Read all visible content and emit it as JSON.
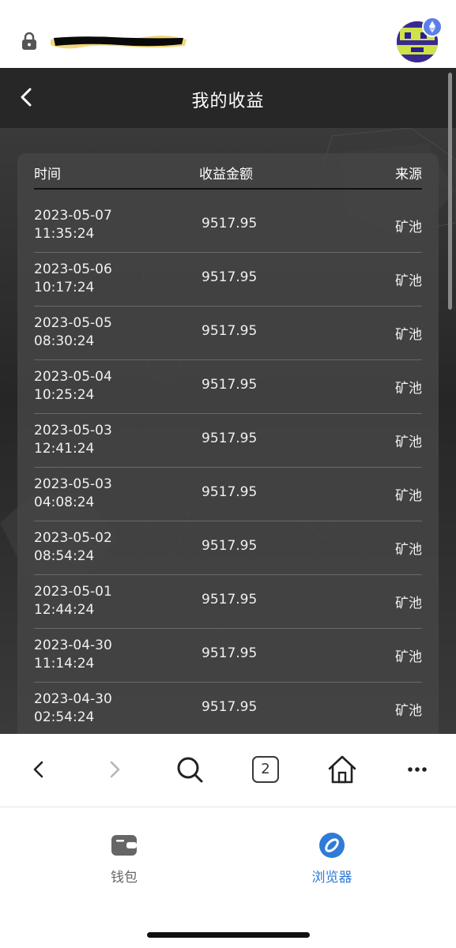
{
  "urlbar": {
    "url": "",
    "lock_icon": "lock-icon",
    "avatar_badge_icon": "ethereum-icon"
  },
  "page": {
    "title": "我的收益",
    "back_icon": "chevron-left-icon"
  },
  "table": {
    "columns": [
      "时间",
      "收益金额",
      "来源"
    ],
    "rows": [
      {
        "date": "2023-05-07",
        "time": "11:35:24",
        "amount": "9517.95",
        "source": "矿池"
      },
      {
        "date": "2023-05-06",
        "time": "10:17:24",
        "amount": "9517.95",
        "source": "矿池"
      },
      {
        "date": "2023-05-05",
        "time": "08:30:24",
        "amount": "9517.95",
        "source": "矿池"
      },
      {
        "date": "2023-05-04",
        "time": "10:25:24",
        "amount": "9517.95",
        "source": "矿池"
      },
      {
        "date": "2023-05-03",
        "time": "12:41:24",
        "amount": "9517.95",
        "source": "矿池"
      },
      {
        "date": "2023-05-03",
        "time": "04:08:24",
        "amount": "9517.95",
        "source": "矿池"
      },
      {
        "date": "2023-05-02",
        "time": "08:54:24",
        "amount": "9517.95",
        "source": "矿池"
      },
      {
        "date": "2023-05-01",
        "time": "12:44:24",
        "amount": "9517.95",
        "source": "矿池"
      },
      {
        "date": "2023-04-30",
        "time": "11:14:24",
        "amount": "9517.95",
        "source": "矿池"
      },
      {
        "date": "2023-04-30",
        "time": "02:54:24",
        "amount": "9517.95",
        "source": "矿池"
      }
    ]
  },
  "toolbar": {
    "tab_count": "2",
    "icons": [
      "back-arrow-icon",
      "forward-arrow-icon",
      "search-icon",
      "tabs-icon",
      "home-icon",
      "more-icon"
    ]
  },
  "tabbar": {
    "tabs": [
      {
        "label": "钱包",
        "icon": "wallet-icon",
        "active": false
      },
      {
        "label": "浏览器",
        "icon": "compass-icon",
        "active": true
      }
    ]
  },
  "colors": {
    "accent": "#2f7bd6",
    "content_bg": "#2b2b2b",
    "card_bg": "#444444",
    "inactive_tab": "#666666"
  }
}
